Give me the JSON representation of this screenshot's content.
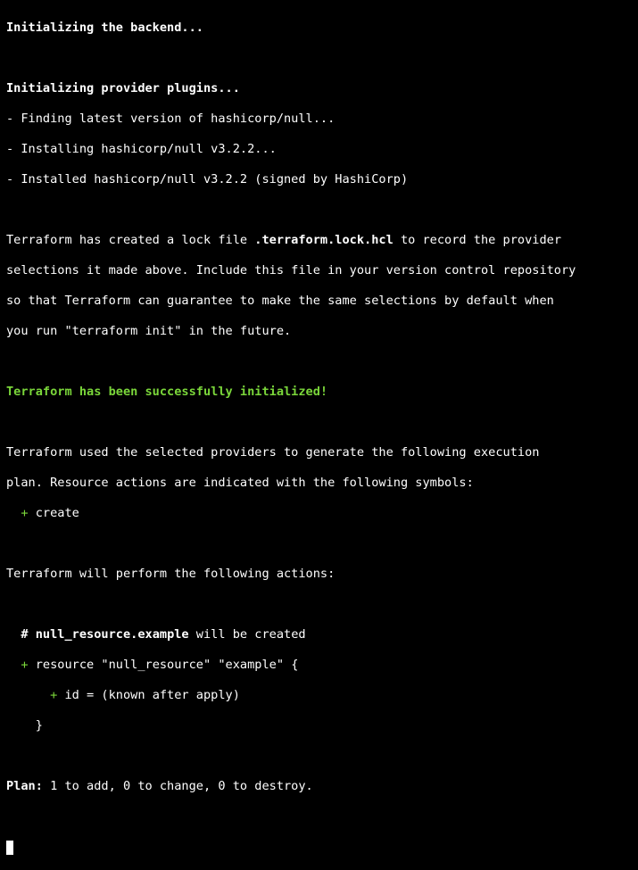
{
  "colors": {
    "background": "#000000",
    "text": "#ffffff",
    "success": "#7ad63a"
  },
  "terminal": {
    "init_backend": "Initializing the backend...",
    "init_plugins": "Initializing provider plugins...",
    "finding": "- Finding latest version of hashicorp/null...",
    "installing": "- Installing hashicorp/null v3.2.2...",
    "installed": "- Installed hashicorp/null v3.2.2 (signed by HashiCorp)",
    "lock_pre": "Terraform has created a lock file ",
    "lock_file": ".terraform.lock.hcl",
    "lock_post": " to record the provider",
    "lock_2": "selections it made above. Include this file in your version control repository",
    "lock_3": "so that Terraform can guarantee to make the same selections by default when",
    "lock_4": "you run \"terraform init\" in the future.",
    "success": "Terraform has been successfully initialized!",
    "plan_intro_1": "Terraform used the selected providers to generate the following execution",
    "plan_intro_2": "plan. Resource actions are indicated with the following symbols:",
    "symbol_indent": "  ",
    "symbol_plus": "+",
    "symbol_label": " create",
    "perform": "Terraform will perform the following actions:",
    "res_indent": "  ",
    "res_hash": "#",
    "res_sp": " ",
    "res_name": "null_resource.example",
    "res_will": " will be created",
    "res_plus_indent": "  ",
    "res_plus": "+",
    "res_decl": " resource \"null_resource\" \"example\" {",
    "attr_indent": "      ",
    "attr_plus": "+",
    "attr_text": " id = (known after apply)",
    "close_brace": "    }",
    "plan_label": "Plan:",
    "plan_summary": " 1 to add, 0 to change, 0 to destroy."
  }
}
